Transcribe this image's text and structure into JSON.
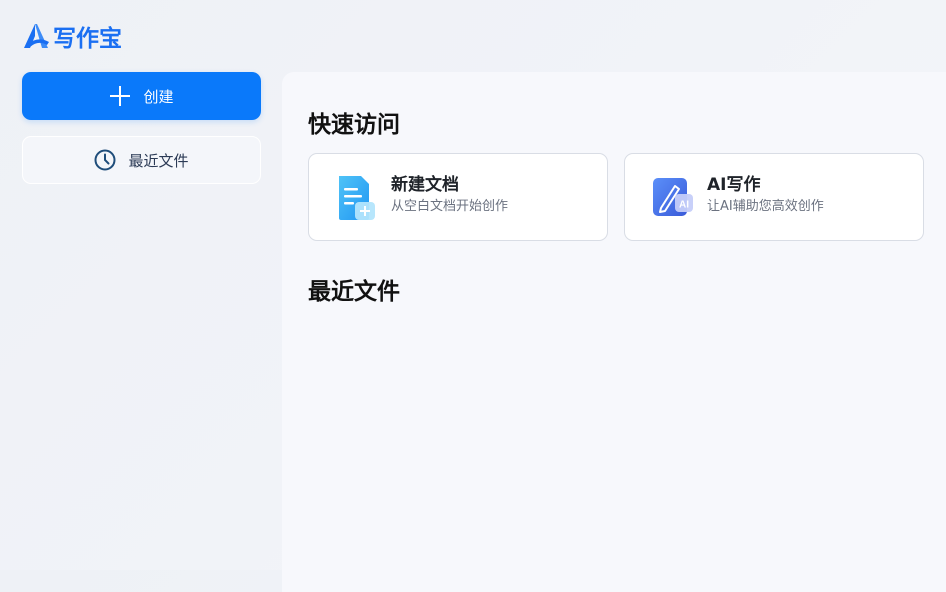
{
  "app": {
    "logo_text": "写作宝"
  },
  "sidebar": {
    "create_label": "创建",
    "recent_label": "最近文件"
  },
  "main": {
    "quick_access_title": "快速访问",
    "cards": [
      {
        "title": "新建文档",
        "desc": "从空白文档开始创作",
        "icon": "new-doc-icon"
      },
      {
        "title": "AI写作",
        "desc": "让AI辅助您高效创作",
        "icon": "ai-pen-icon"
      }
    ],
    "recent_title": "最近文件"
  },
  "colors": {
    "accent": "#0a79fa",
    "logo": "#1a6ff2"
  }
}
